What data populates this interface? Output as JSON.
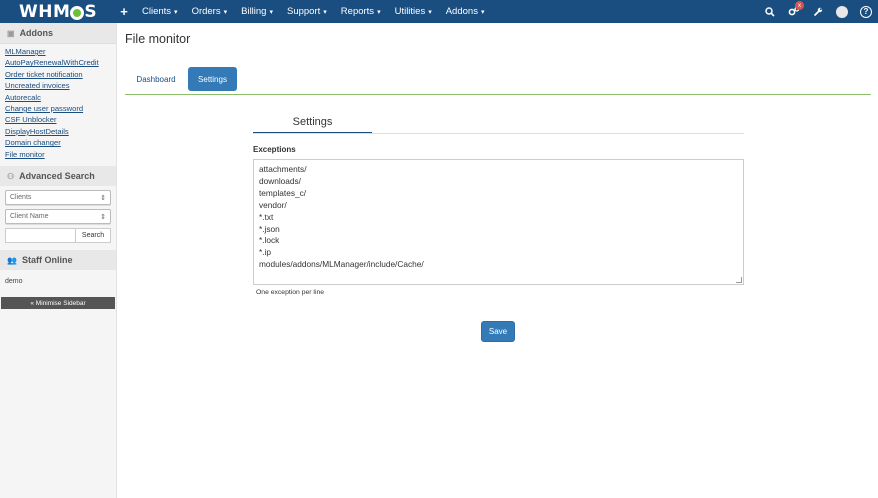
{
  "app": {
    "logo_prefix": "WHM",
    "logo_suffix": "S"
  },
  "nav": {
    "plus": "+",
    "items": [
      "Clients",
      "Orders",
      "Billing",
      "Support",
      "Reports",
      "Utilities",
      "Addons"
    ],
    "caret": "▾",
    "notification_count": "x",
    "help_glyph": "?"
  },
  "sidebar": {
    "addons_title": "Addons",
    "addon_links": [
      "MLManager",
      "AutoPayRenewalWithCredit",
      "Order ticket notification",
      "Uncreated invoices",
      "Autorecalc",
      "Change user password",
      "CSF Unblocker",
      "DisplayHostDetails",
      "Domain changer",
      "File monitor"
    ],
    "advanced_search_title": "Advanced Search",
    "search_type_selected": "Clients",
    "search_field_selected": "Client Name",
    "search_button": "Search",
    "staff_online_title": "Staff Online",
    "staff_online_user": "demo",
    "minimise_label": "« Minimise Sidebar"
  },
  "main": {
    "page_title": "File monitor",
    "tabs": [
      {
        "label": "Dashboard",
        "active": false
      },
      {
        "label": "Settings",
        "active": true
      }
    ],
    "section_title": "Settings",
    "exceptions_label": "Exceptions",
    "exceptions_value": [
      "attachments/",
      "downloads/",
      "templates_c/",
      "vendor/",
      "*.txt",
      "*.json",
      "*.lock",
      "*.ip",
      "modules/addons/MLManager/include/Cache/"
    ],
    "help_text": "One exception per line",
    "save_label": "Save"
  },
  "colors": {
    "navbar": "#1a4d80",
    "primary_button": "#337ab7",
    "tab_border": "#8cbf6b",
    "badge": "#d9534f"
  }
}
